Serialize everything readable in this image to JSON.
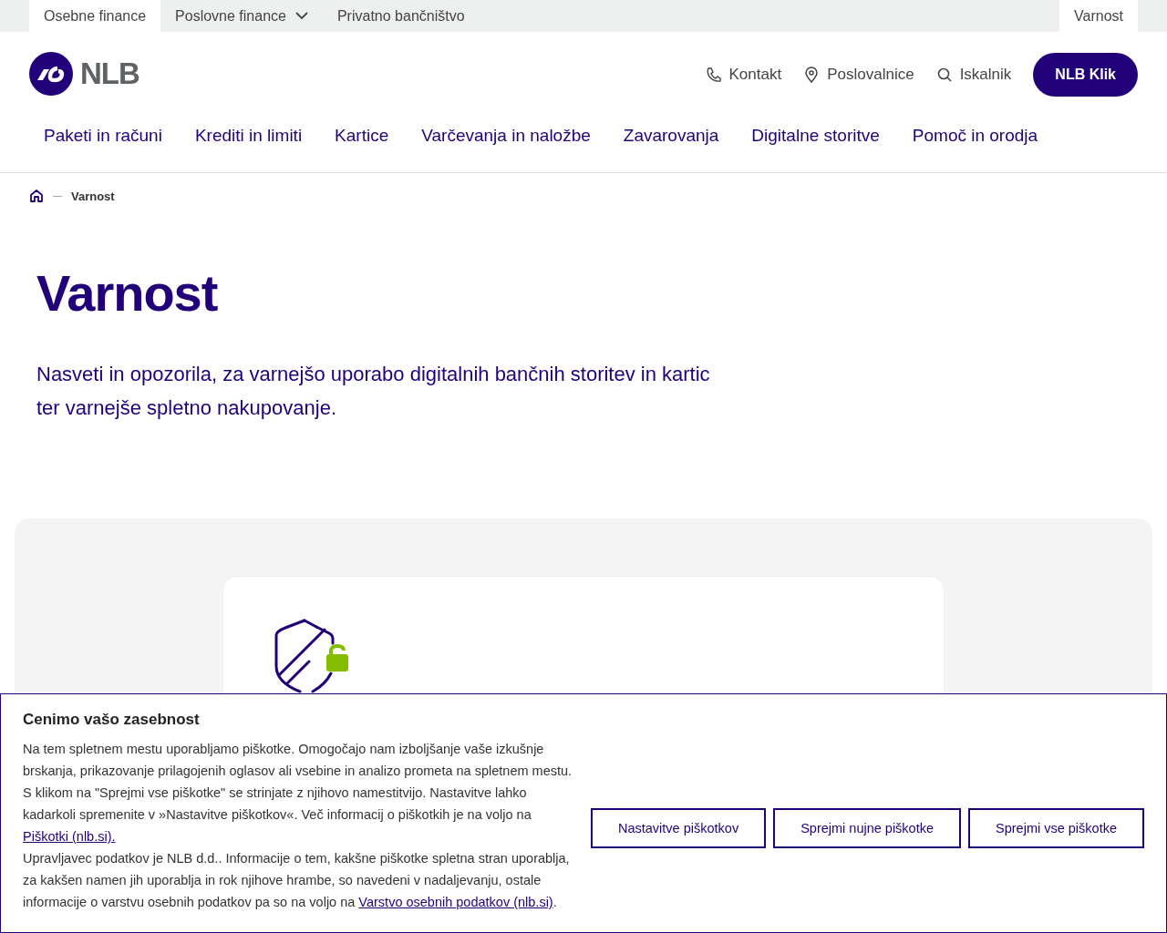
{
  "top_bar": {
    "tabs": [
      {
        "label": "Osebne finance",
        "selected": true,
        "dropdown": false
      },
      {
        "label": "Poslovne finance",
        "selected": false,
        "dropdown": true
      },
      {
        "label": "Privatno bančništvo",
        "selected": false,
        "dropdown": false
      }
    ],
    "right_tab": {
      "label": "Varnost",
      "selected": true
    }
  },
  "header": {
    "logo_text": "NLB",
    "utility_links": [
      {
        "label": "Kontakt",
        "kind": "phone"
      },
      {
        "label": "Poslovalnice",
        "kind": "location"
      },
      {
        "label": "Iskalnik",
        "kind": "search"
      }
    ],
    "cta_button": "NLB Klik"
  },
  "main_nav": [
    "Paketi in računi",
    "Krediti in limiti",
    "Kartice",
    "Varčevanja in naložbe",
    "Zavarovanja",
    "Digitalne storitve",
    "Pomoč in orodja"
  ],
  "breadcrumb": {
    "current": "Varnost"
  },
  "page": {
    "title": "Varnost",
    "intro": "Nasveti in opozorila, za varnejšo uporabo digitalnih bančnih storitev in kartic ter varnejše spletno nakupovanje."
  },
  "cookie_banner": {
    "title": "Cenimo vašo zasebnost",
    "paragraphs": [
      {
        "text": "Na tem spletnem mestu uporabljamo piškotke. Omogočajo nam izboljšanje vaše izkušnje brskanja, prikazovanje prilagojenih oglasov ali vsebine in analizo prometa na spletnem mestu. S klikom na \"Sprejmi vse piškotke\" se strinjate z njihovo namestitvijo. Nastavitve lahko kadarkoli spremenite v »Nastavitve piškotkov«. Več informacij o piškotkih je na voljo na",
        "link": "Piškotki (nlb.si)."
      },
      {
        "text": "Upravljavec podatkov je NLB d.d.. Informacije o tem, kakšne piškotke spletna stran uporablja, za kakšen namen jih uporablja in rok njihove hrambe, so navedeni v nadaljevanju, ostale informacije o varstvu osebnih podatkov pa so na voljo na",
        "link": "Varstvo osebnih podatkov (nlb.si)",
        "after": "."
      }
    ],
    "buttons": [
      "Nastavitve piškotkov",
      "Sprejmi nujne piškotke",
      "Sprejmi vse piškotke"
    ]
  }
}
